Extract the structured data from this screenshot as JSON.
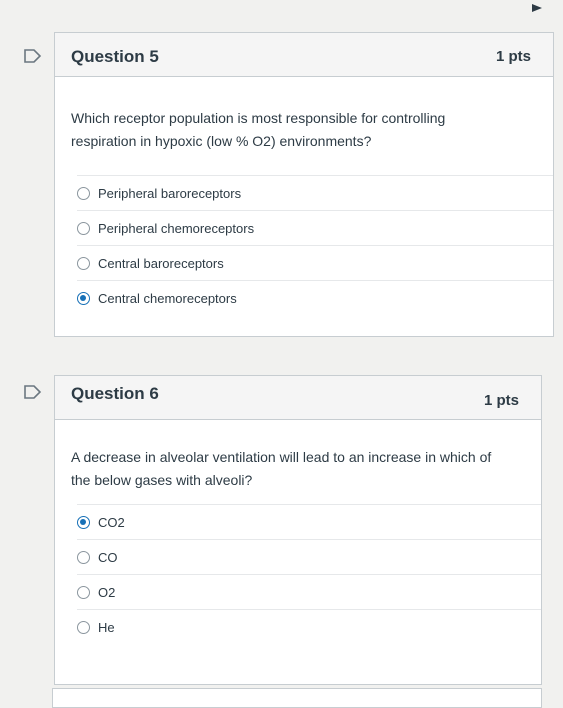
{
  "questions": [
    {
      "title": "Question 5",
      "points": "1 pts",
      "text": "Which receptor population is most responsible for controlling respiration in hypoxic (low % O2) environments?",
      "answers": [
        {
          "label": "Peripheral baroreceptors",
          "selected": false
        },
        {
          "label": "Peripheral chemoreceptors",
          "selected": false
        },
        {
          "label": "Central baroreceptors",
          "selected": false
        },
        {
          "label": "Central chemoreceptors",
          "selected": true
        }
      ]
    },
    {
      "title": "Question 6",
      "points": "1 pts",
      "text": "A decrease in alveolar ventilation will lead to an increase in which of the below gases with alveoli?",
      "answers": [
        {
          "label": "CO2",
          "selected": true
        },
        {
          "label": "CO",
          "selected": false
        },
        {
          "label": "O2",
          "selected": false
        },
        {
          "label": "He",
          "selected": false
        }
      ]
    }
  ],
  "colors": {
    "accent": "#1770b7",
    "header_bg": "#f5f5f5",
    "border": "#c7cdd1",
    "page_bg": "#f1f1ef"
  },
  "icons": {
    "flag": "flag-outline-icon"
  }
}
